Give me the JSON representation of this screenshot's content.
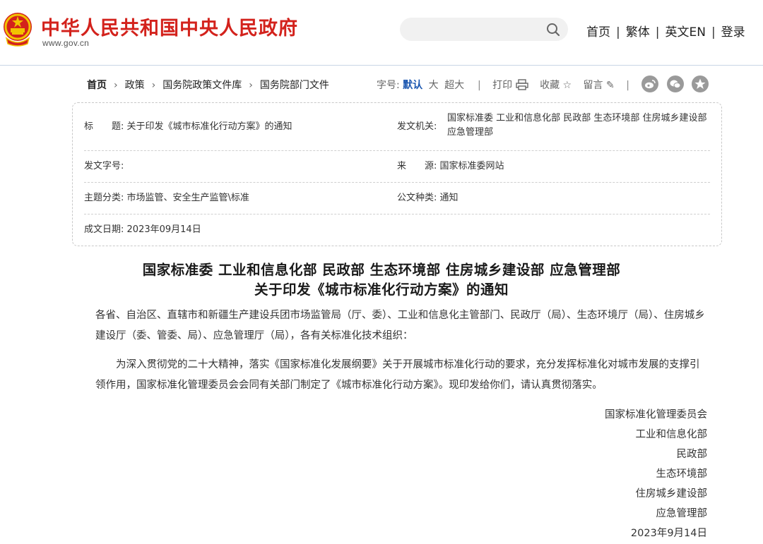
{
  "header": {
    "site_title": "中华人民共和国中央人民政府",
    "site_url": "www.gov.cn",
    "search_placeholder": "",
    "links": [
      "首页",
      "繁体",
      "英文EN",
      "登录"
    ]
  },
  "breadcrumb": [
    "首页",
    "政策",
    "国务院政策文件库",
    "国务院部门文件"
  ],
  "font_size": {
    "label": "字号:",
    "options": [
      "默认",
      "大",
      "超大"
    ]
  },
  "tools": {
    "print": "打印",
    "favorite": "收藏",
    "comment": "留言"
  },
  "info": {
    "title_label": "标　　题:",
    "title_value": "关于印发《城市标准化行动方案》的通知",
    "issuer_label": "发文机关:",
    "issuer_value": "国家标准委 工业和信息化部 民政部 生态环境部 住房城乡建设部 应急管理部",
    "docnum_label": "发文字号:",
    "docnum_value": "",
    "source_label": "来　　源:",
    "source_value": "国家标准委网站",
    "category_label": "主题分类:",
    "category_value": "市场监管、安全生产监管\\标准",
    "doctype_label": "公文种类:",
    "doctype_value": "通知",
    "date_label": "成文日期:",
    "date_value": "2023年09月14日"
  },
  "article": {
    "title_line1": "国家标准委 工业和信息化部 民政部 生态环境部 住房城乡建设部 应急管理部",
    "title_line2": "关于印发《城市标准化行动方案》的通知",
    "salutation": "各省、自治区、直辖市和新疆生产建设兵团市场监管局（厅、委）、工业和信息化主管部门、民政厅（局）、生态环境厅（局）、住房城乡建设厅（委、管委、局）、应急管理厅（局），各有关标准化技术组织：",
    "body": "为深入贯彻党的二十大精神，落实《国家标准化发展纲要》关于开展城市标准化行动的要求，充分发挥标准化对城市发展的支撑引领作用，国家标准化管理委员会会同有关部门制定了《城市标准化行动方案》。现印发给你们，请认真贯彻落实。",
    "signatures": [
      "国家标准化管理委员会",
      "工业和信息化部",
      "民政部",
      "生态环境部",
      "住房城乡建设部",
      "应急管理部",
      "2023年9月14日"
    ]
  },
  "colors": {
    "brand_red": "#d3221c",
    "accent_blue": "#1a56b0",
    "share_grey": "#9a9a9a"
  },
  "icons": [
    "national-emblem-icon",
    "search-icon",
    "print-icon",
    "star-icon",
    "pencil-icon",
    "weibo-icon",
    "wechat-icon",
    "qzone-icon"
  ]
}
